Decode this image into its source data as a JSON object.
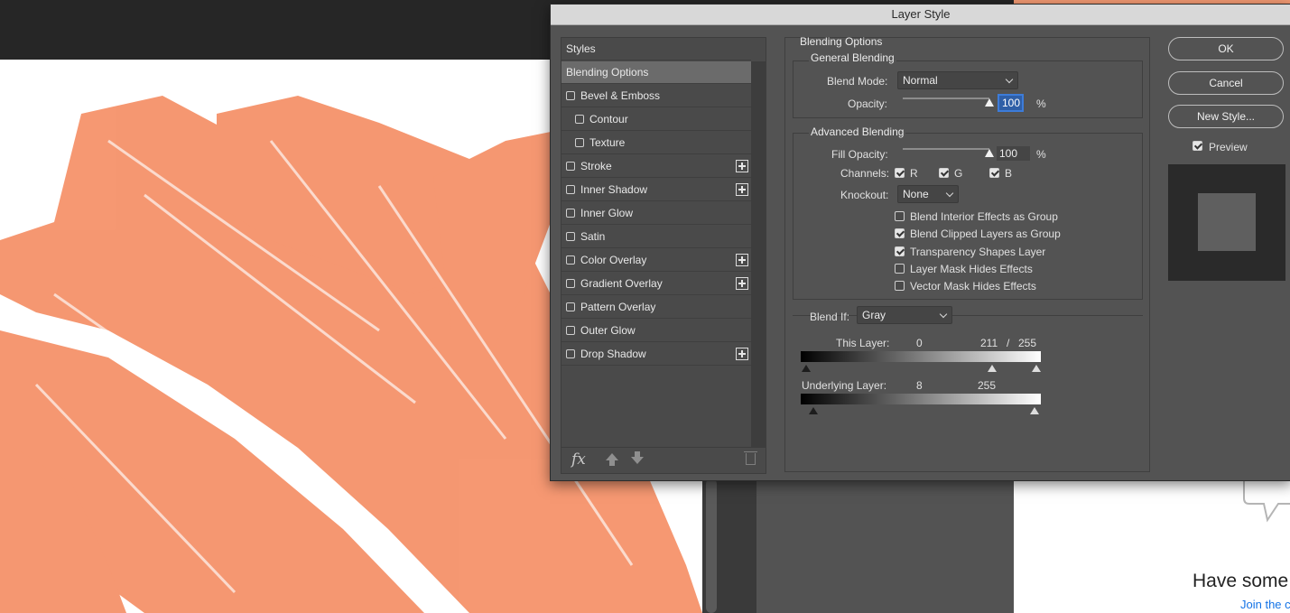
{
  "dialog": {
    "title": "Layer Style",
    "styles_header": "Styles",
    "styles": [
      {
        "label": "Blending Options",
        "has_checkbox": false,
        "checked": false,
        "has_plus": false,
        "selected": true,
        "indent": 0
      },
      {
        "label": "Bevel & Emboss",
        "has_checkbox": true,
        "checked": false,
        "has_plus": false,
        "selected": false,
        "indent": 0
      },
      {
        "label": "Contour",
        "has_checkbox": true,
        "checked": false,
        "has_plus": false,
        "selected": false,
        "indent": 1
      },
      {
        "label": "Texture",
        "has_checkbox": true,
        "checked": false,
        "has_plus": false,
        "selected": false,
        "indent": 1
      },
      {
        "label": "Stroke",
        "has_checkbox": true,
        "checked": false,
        "has_plus": true,
        "selected": false,
        "indent": 0
      },
      {
        "label": "Inner Shadow",
        "has_checkbox": true,
        "checked": false,
        "has_plus": true,
        "selected": false,
        "indent": 0
      },
      {
        "label": "Inner Glow",
        "has_checkbox": true,
        "checked": false,
        "has_plus": false,
        "selected": false,
        "indent": 0
      },
      {
        "label": "Satin",
        "has_checkbox": true,
        "checked": false,
        "has_plus": false,
        "selected": false,
        "indent": 0
      },
      {
        "label": "Color Overlay",
        "has_checkbox": true,
        "checked": false,
        "has_plus": true,
        "selected": false,
        "indent": 0
      },
      {
        "label": "Gradient Overlay",
        "has_checkbox": true,
        "checked": false,
        "has_plus": true,
        "selected": false,
        "indent": 0
      },
      {
        "label": "Pattern Overlay",
        "has_checkbox": true,
        "checked": false,
        "has_plus": false,
        "selected": false,
        "indent": 0
      },
      {
        "label": "Outer Glow",
        "has_checkbox": true,
        "checked": false,
        "has_plus": false,
        "selected": false,
        "indent": 0
      },
      {
        "label": "Drop Shadow",
        "has_checkbox": true,
        "checked": false,
        "has_plus": true,
        "selected": false,
        "indent": 0
      }
    ],
    "footer_icons": [
      "fx-icon",
      "move-up-icon",
      "move-down-icon",
      "trash-icon"
    ],
    "blending": {
      "title": "Blending Options",
      "general_title": "General Blending",
      "blend_mode_label": "Blend Mode:",
      "blend_mode_value": "Normal",
      "opacity_label": "Opacity:",
      "opacity_value": "100",
      "opacity_unit": "%",
      "opacity_fraction": 1.0,
      "advanced_title": "Advanced Blending",
      "fill_opacity_label": "Fill Opacity:",
      "fill_opacity_value": "100",
      "fill_opacity_unit": "%",
      "fill_opacity_fraction": 1.0,
      "channels_label": "Channels:",
      "channels": [
        {
          "label": "R",
          "checked": true
        },
        {
          "label": "G",
          "checked": true
        },
        {
          "label": "B",
          "checked": true
        }
      ],
      "knockout_label": "Knockout:",
      "knockout_value": "None",
      "options": [
        {
          "label": "Blend Interior Effects as Group",
          "checked": false
        },
        {
          "label": "Blend Clipped Layers as Group",
          "checked": true
        },
        {
          "label": "Transparency Shapes Layer",
          "checked": true
        },
        {
          "label": "Layer Mask Hides Effects",
          "checked": false
        },
        {
          "label": "Vector Mask Hides Effects",
          "checked": false
        }
      ],
      "blend_if_label": "Blend If:",
      "blend_if_value": "Gray",
      "this_layer_label": "This Layer:",
      "this_layer_low": "0",
      "this_layer_high_a": "211",
      "this_layer_sep": "/",
      "this_layer_high_b": "255",
      "underlying_label": "Underlying Layer:",
      "underlying_low": "8",
      "underlying_high": "255"
    },
    "buttons": {
      "ok": "OK",
      "cancel": "Cancel",
      "new_style": "New Style..."
    },
    "preview_label": "Preview",
    "preview_checked": true
  },
  "background": {
    "headline": "Have some",
    "link": "Join the c",
    "brush_color": "#f5926a"
  }
}
